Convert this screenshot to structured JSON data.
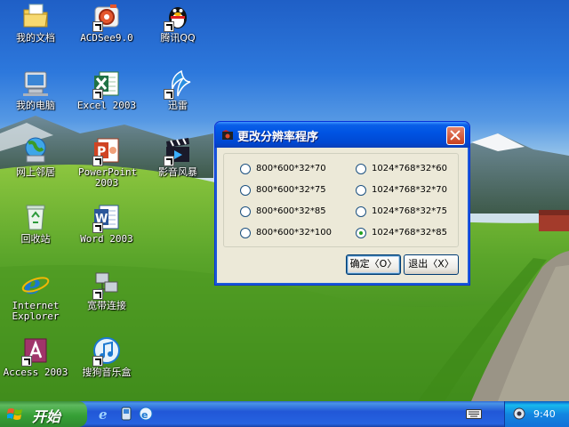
{
  "desktop": {
    "icons": [
      {
        "label": "我的文档",
        "icon": "my-documents-icon"
      },
      {
        "label": "ACDSee9.0",
        "icon": "acdsee-icon"
      },
      {
        "label": "腾讯QQ",
        "icon": "qq-penguin-icon"
      },
      {
        "label": "我的电脑",
        "icon": "my-computer-icon"
      },
      {
        "label": "Excel 2003",
        "icon": "excel-icon"
      },
      {
        "label": "迅雷",
        "icon": "thunder-icon"
      },
      {
        "label": "网上邻居",
        "icon": "network-places-icon"
      },
      {
        "label": "PowerPoint 2003",
        "icon": "powerpoint-icon"
      },
      {
        "label": "影音风暴",
        "icon": "media-player-clapper-icon"
      },
      {
        "label": "回收站",
        "icon": "recycle-bin-icon"
      },
      {
        "label": "Word 2003",
        "icon": "word-icon"
      },
      {
        "label": "Internet Explorer",
        "icon": "internet-explorer-icon"
      },
      {
        "label": "宽带连接",
        "icon": "broadband-connection-icon"
      },
      {
        "label": "Access 2003",
        "icon": "access-icon"
      },
      {
        "label": "搜狗音乐盒",
        "icon": "sogou-music-icon"
      }
    ]
  },
  "dialog": {
    "title": "更改分辨率程序",
    "options": [
      {
        "label": "800*600*32*70",
        "selected": false
      },
      {
        "label": "800*600*32*75",
        "selected": false
      },
      {
        "label": "800*600*32*85",
        "selected": false
      },
      {
        "label": "800*600*32*100",
        "selected": false
      },
      {
        "label": "1024*768*32*60",
        "selected": false
      },
      {
        "label": "1024*768*32*70",
        "selected": false
      },
      {
        "label": "1024*768*32*75",
        "selected": false
      },
      {
        "label": "1024*768*32*85",
        "selected": true
      }
    ],
    "ok_label": "确定〈O〉",
    "exit_label": "退出〈X〉"
  },
  "taskbar": {
    "start_label": "开始",
    "clock": "9:40"
  },
  "colors": {
    "titlebar": "#0054e3",
    "taskbar": "#2157d7",
    "start_button": "#36a036",
    "dialog_face": "#ece9d8"
  }
}
